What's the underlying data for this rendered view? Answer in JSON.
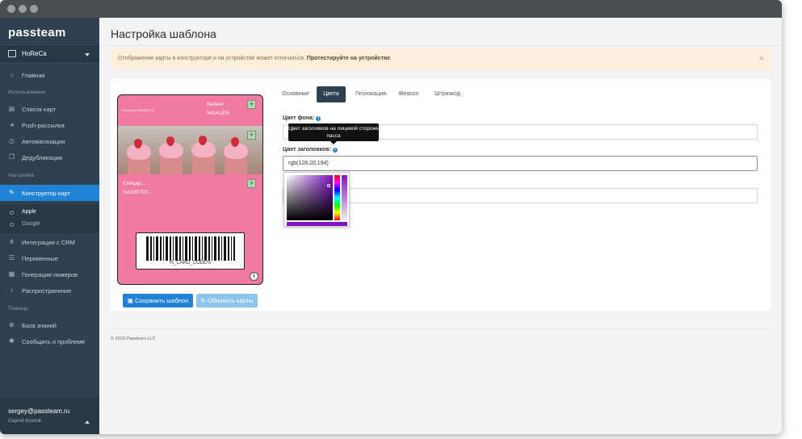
{
  "sidebar": {
    "logo": "passteam",
    "org": "HoReCa",
    "items": [
      {
        "label": "Главная",
        "icon": "home-icon"
      },
      {
        "label": "Список карт",
        "icon": "cart-icon"
      },
      {
        "label": "Push-рассылка",
        "icon": "megaphone-icon"
      },
      {
        "label": "Автоматизация",
        "icon": "clock-icon"
      },
      {
        "label": "Дедубликация",
        "icon": "copy-icon"
      },
      {
        "label": "Конструктор карт",
        "icon": "brush-icon"
      },
      {
        "label": "Интеграции с CRM",
        "icon": "sitemap-icon"
      },
      {
        "label": "Переменные",
        "icon": "list-icon"
      },
      {
        "label": "Генерация номеров",
        "icon": "grid-icon"
      },
      {
        "label": "Распространение",
        "icon": "bell-icon"
      },
      {
        "label": "База знаний",
        "icon": "lifebuoy-icon"
      },
      {
        "label": "Сообщить о проблеме",
        "icon": "bug-icon"
      }
    ],
    "sections": {
      "usage": "Использование",
      "settings": "Настройка",
      "help": "Помощь"
    },
    "subitems": [
      {
        "label": " Apple"
      },
      {
        "label": " Google"
      }
    ],
    "user": {
      "email": "sergey@passteam.ru",
      "name": "Сергей Козлов"
    }
  },
  "main": {
    "title": "Настройка шаблона",
    "alert": {
      "text": "Отображение карты в конструкторе и на устройстве может отличаться. ",
      "bold": "Протестируйте на устройстве",
      "end": "."
    },
    "card": {
      "brand": "Passteam DASHBOCK",
      "balance_label": "баланс",
      "balance_value": "%SALE%",
      "secondary_label": "Специр...",
      "secondary_value": "%1535703...",
      "barcode_text": "%_CARD_CODE%"
    },
    "buttons": {
      "save": "Сохранить шаблон",
      "refresh": "Обновить карты"
    },
    "tabs": [
      "Основные",
      "Цвета",
      "Геолокация",
      "iBeacon",
      "Штрихкод"
    ],
    "active_tab": "Цвета",
    "fields": {
      "bg_label": "Цвет фона:",
      "header_label": "Цвет заголовков:",
      "header_value": "rgb(128,20,194)",
      "tooltip": "Цвет заголовков на лицевой стороне пасса"
    },
    "footer": "© 2019 Passteam LLC"
  },
  "colors": {
    "accent": "#1f82d6",
    "sidebar": "#2f4050",
    "card_bg": "#f07aa3",
    "header_color": "#8014c2"
  }
}
